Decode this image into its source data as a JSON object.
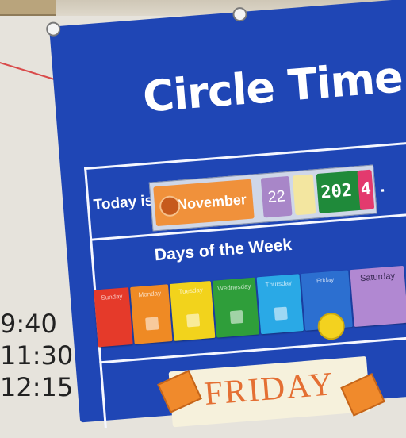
{
  "chart": {
    "title": "Circle Time",
    "today_label": "Today is",
    "month": "November",
    "day": "22",
    "year_prefix": "202",
    "year_last_digit": "4",
    "period": ".",
    "days_title": "Days of the Week",
    "days": [
      {
        "label": "Sunday",
        "color": "#e53a2a"
      },
      {
        "label": "Monday",
        "color": "#ef8a24"
      },
      {
        "label": "Tuesday",
        "color": "#f2d31c"
      },
      {
        "label": "Wednesday",
        "color": "#2f9e3a"
      },
      {
        "label": "Thursday",
        "color": "#2aa9e6"
      },
      {
        "label": "Friday",
        "color": "#2c6fd0"
      },
      {
        "label": "Saturday",
        "color": "#b188d2"
      }
    ],
    "selected_day_card": "FRIDAY"
  },
  "whiteboard_times": [
    "9:40",
    "11:30",
    "12:15"
  ],
  "colors": {
    "chart_blue": "#1f46b5",
    "month_orange": "#f0913b",
    "year_green": "#1f8a3a"
  }
}
